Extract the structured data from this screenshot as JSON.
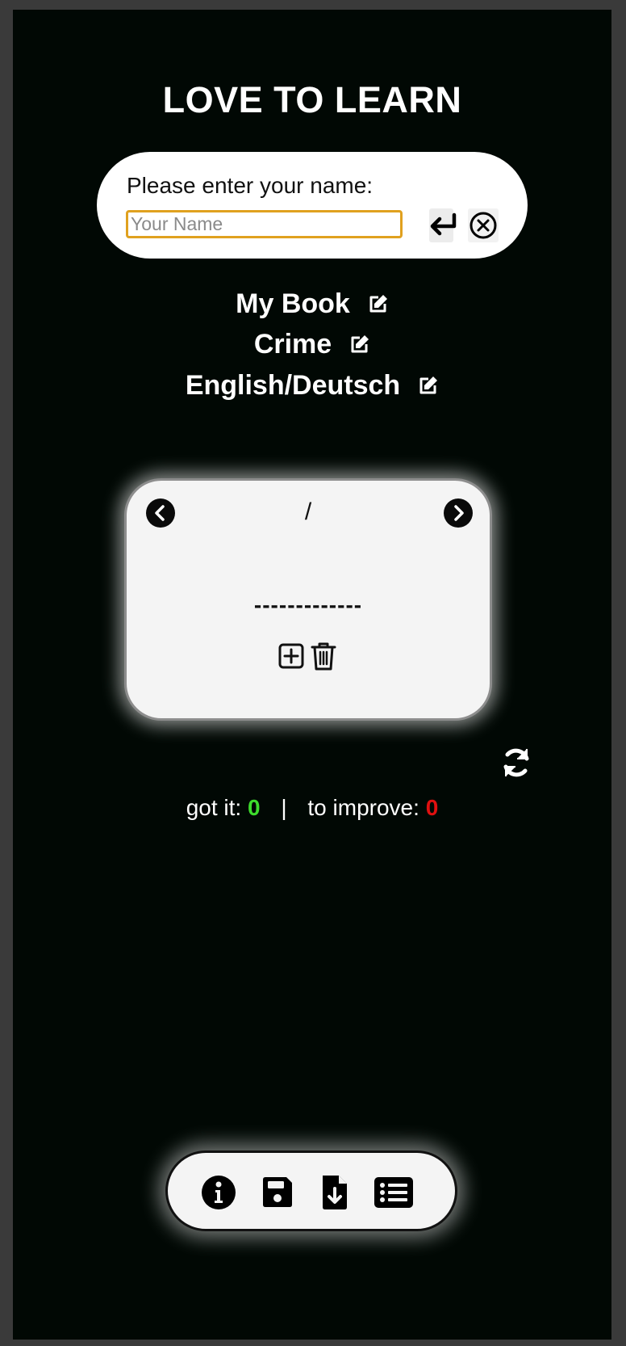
{
  "app": {
    "title": "LOVE TO LEARN"
  },
  "name_panel": {
    "prompt": "Please enter your name:",
    "input_value": "",
    "input_placeholder": "Your Name",
    "enter_icon": "enter-arrow-icon",
    "cancel_icon": "close-circle-icon",
    "accent_color": "#e0a11f"
  },
  "book": {
    "title": "My Book",
    "genre": "Crime",
    "languages": "English/Deutsch",
    "edit_icon": "edit-icon"
  },
  "card": {
    "counter": "/",
    "word": "-------------",
    "prev_icon": "chevron-left-icon",
    "next_icon": "chevron-right-icon",
    "add_icon": "add-icon",
    "delete_icon": "trash-icon"
  },
  "refresh_icon": "refresh-icon",
  "score": {
    "got_it_label": "got it:",
    "got_it_value": "0",
    "separator": "|",
    "to_improve_label": "to improve:",
    "to_improve_value": "0",
    "got_it_color": "#3ddc2c",
    "to_improve_color": "#e01010"
  },
  "toolbar": {
    "icons": [
      "info-icon",
      "save-icon",
      "file-download-icon",
      "list-icon"
    ]
  },
  "colors": {
    "background": "#010804",
    "frame": "#3a3a3a"
  }
}
